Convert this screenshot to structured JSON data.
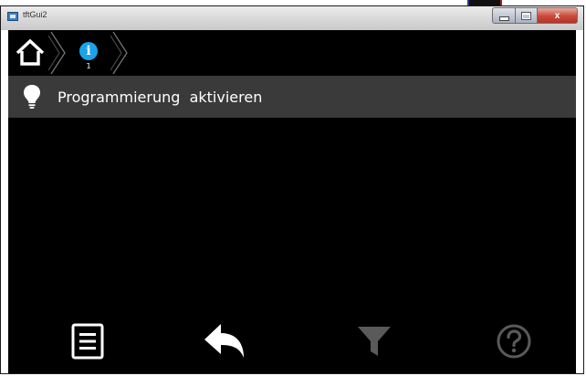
{
  "window": {
    "title": "tftGui2",
    "controls": {
      "minimize": "minimize",
      "maximize": "maximize",
      "close": "x"
    }
  },
  "breadcrumb": {
    "items": [
      {
        "icon": "home-icon"
      },
      {
        "icon": "info-icon",
        "glyph": "i",
        "counter": "1",
        "color": "#1aa3e8"
      }
    ]
  },
  "list": {
    "items": [
      {
        "icon": "lightbulb-icon",
        "label": "Programmierung  aktivieren"
      }
    ]
  },
  "toolbar": {
    "buttons": [
      {
        "icon": "menu-list-icon",
        "enabled": true
      },
      {
        "icon": "back-arrow-icon",
        "enabled": true
      },
      {
        "icon": "filter-icon",
        "enabled": false
      },
      {
        "icon": "help-icon",
        "enabled": false
      }
    ]
  },
  "colors": {
    "background": "#000000",
    "list_item": "#3a3a3a",
    "accent": "#1aa3e8",
    "icon_enabled": "#ffffff",
    "icon_disabled": "#5a5a5a",
    "close_button": "#c8493a"
  }
}
